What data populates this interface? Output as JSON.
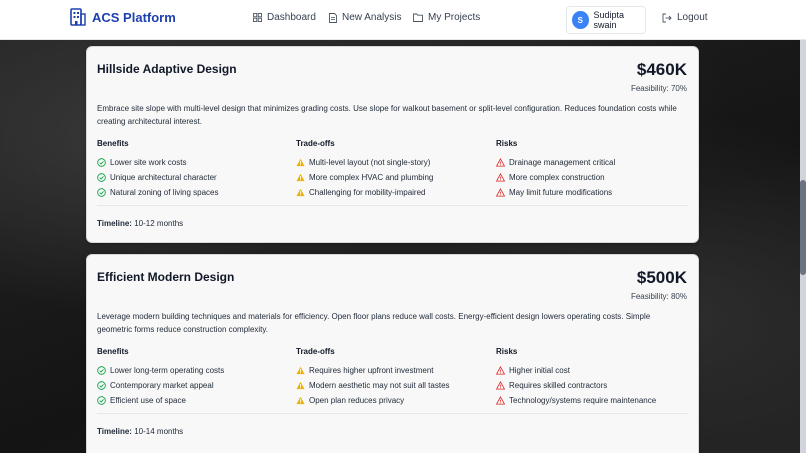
{
  "navbar": {
    "brand": "ACS Platform",
    "links": [
      {
        "label": "Dashboard",
        "icon": "grid-icon"
      },
      {
        "label": "New Analysis",
        "icon": "document-icon"
      },
      {
        "label": "My Projects",
        "icon": "folder-icon"
      }
    ],
    "user": {
      "initial": "S",
      "name": "Sudipta swain"
    },
    "logout_label": "Logout"
  },
  "colors": {
    "brand": "#1e40af",
    "benefit": "#16a34a",
    "tradeoff": "#eab308",
    "risk": "#dc2626",
    "avatar": "#3b82f6"
  },
  "designs": [
    {
      "title": "Hillside Adaptive Design",
      "price": "$460K",
      "feasibility": "Feasibility: 70%",
      "description": "Embrace site slope with multi-level design that minimizes grading costs. Use slope for walkout basement or split-level configuration. Reduces foundation costs while creating architectural interest.",
      "benefits_heading": "Benefits",
      "tradeoffs_heading": "Trade-offs",
      "risks_heading": "Risks",
      "benefits": [
        "Lower site work costs",
        "Unique architectural character",
        "Natural zoning of living spaces"
      ],
      "tradeoffs": [
        "Multi-level layout (not single-story)",
        "More complex HVAC and plumbing",
        "Challenging for mobility-impaired"
      ],
      "risks": [
        "Drainage management critical",
        "More complex construction",
        "May limit future modifications"
      ],
      "timeline_label": "Timeline:",
      "timeline_value": "10-12 months"
    },
    {
      "title": "Efficient Modern Design",
      "price": "$500K",
      "feasibility": "Feasibility: 80%",
      "description": "Leverage modern building techniques and materials for efficiency. Open floor plans reduce wall costs. Energy-efficient design lowers operating costs. Simple geometric forms reduce construction complexity.",
      "benefits_heading": "Benefits",
      "tradeoffs_heading": "Trade-offs",
      "risks_heading": "Risks",
      "benefits": [
        "Lower long-term operating costs",
        "Contemporary market appeal",
        "Efficient use of space"
      ],
      "tradeoffs": [
        "Requires higher upfront investment",
        "Modern aesthetic may not suit all tastes",
        "Open plan reduces privacy"
      ],
      "risks": [
        "Higher initial cost",
        "Requires skilled contractors",
        "Technology/systems require maintenance"
      ],
      "timeline_label": "Timeline:",
      "timeline_value": "10-14 months"
    }
  ]
}
